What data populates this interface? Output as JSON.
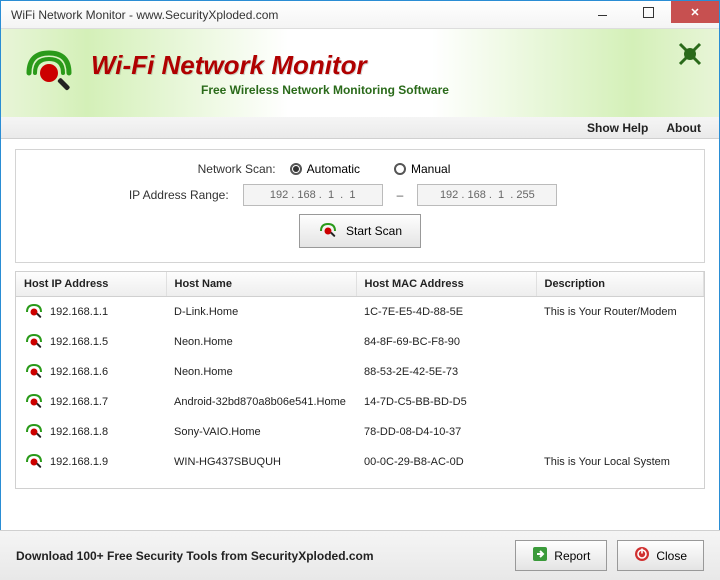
{
  "window": {
    "title": "WiFi Network Monitor - www.SecurityXploded.com"
  },
  "banner": {
    "title": "Wi-Fi Network Monitor",
    "subtitle": "Free Wireless Network Monitoring Software"
  },
  "menu": {
    "help": "Show Help",
    "about": "About"
  },
  "controls": {
    "scan_label": "Network Scan:",
    "auto": "Automatic",
    "manual": "Manual",
    "range_label": "IP Address Range:",
    "ip_from": "192 . 168 .  1  .  1",
    "ip_to": "192 . 168 .  1  . 255",
    "start": "Start Scan"
  },
  "columns": {
    "ip": "Host IP Address",
    "name": "Host Name",
    "mac": "Host MAC Address",
    "desc": "Description"
  },
  "rows": [
    {
      "ip": "192.168.1.1",
      "name": "D-Link.Home",
      "mac": "1C-7E-E5-4D-88-5E",
      "desc": "This is Your Router/Modem"
    },
    {
      "ip": "192.168.1.5",
      "name": "Neon.Home",
      "mac": "84-8F-69-BC-F8-90",
      "desc": ""
    },
    {
      "ip": "192.168.1.6",
      "name": "Neon.Home",
      "mac": "88-53-2E-42-5E-73",
      "desc": ""
    },
    {
      "ip": "192.168.1.7",
      "name": "Android-32bd870a8b06e541.Home",
      "mac": "14-7D-C5-BB-BD-D5",
      "desc": ""
    },
    {
      "ip": "192.168.1.8",
      "name": "Sony-VAIO.Home",
      "mac": "78-DD-08-D4-10-37",
      "desc": ""
    },
    {
      "ip": "192.168.1.9",
      "name": "WIN-HG437SBUQUH",
      "mac": "00-0C-29-B8-AC-0D",
      "desc": "This is Your Local System"
    }
  ],
  "footer": {
    "text": "Download 100+ Free Security Tools from SecurityXploded.com",
    "report": "Report",
    "close": "Close"
  }
}
